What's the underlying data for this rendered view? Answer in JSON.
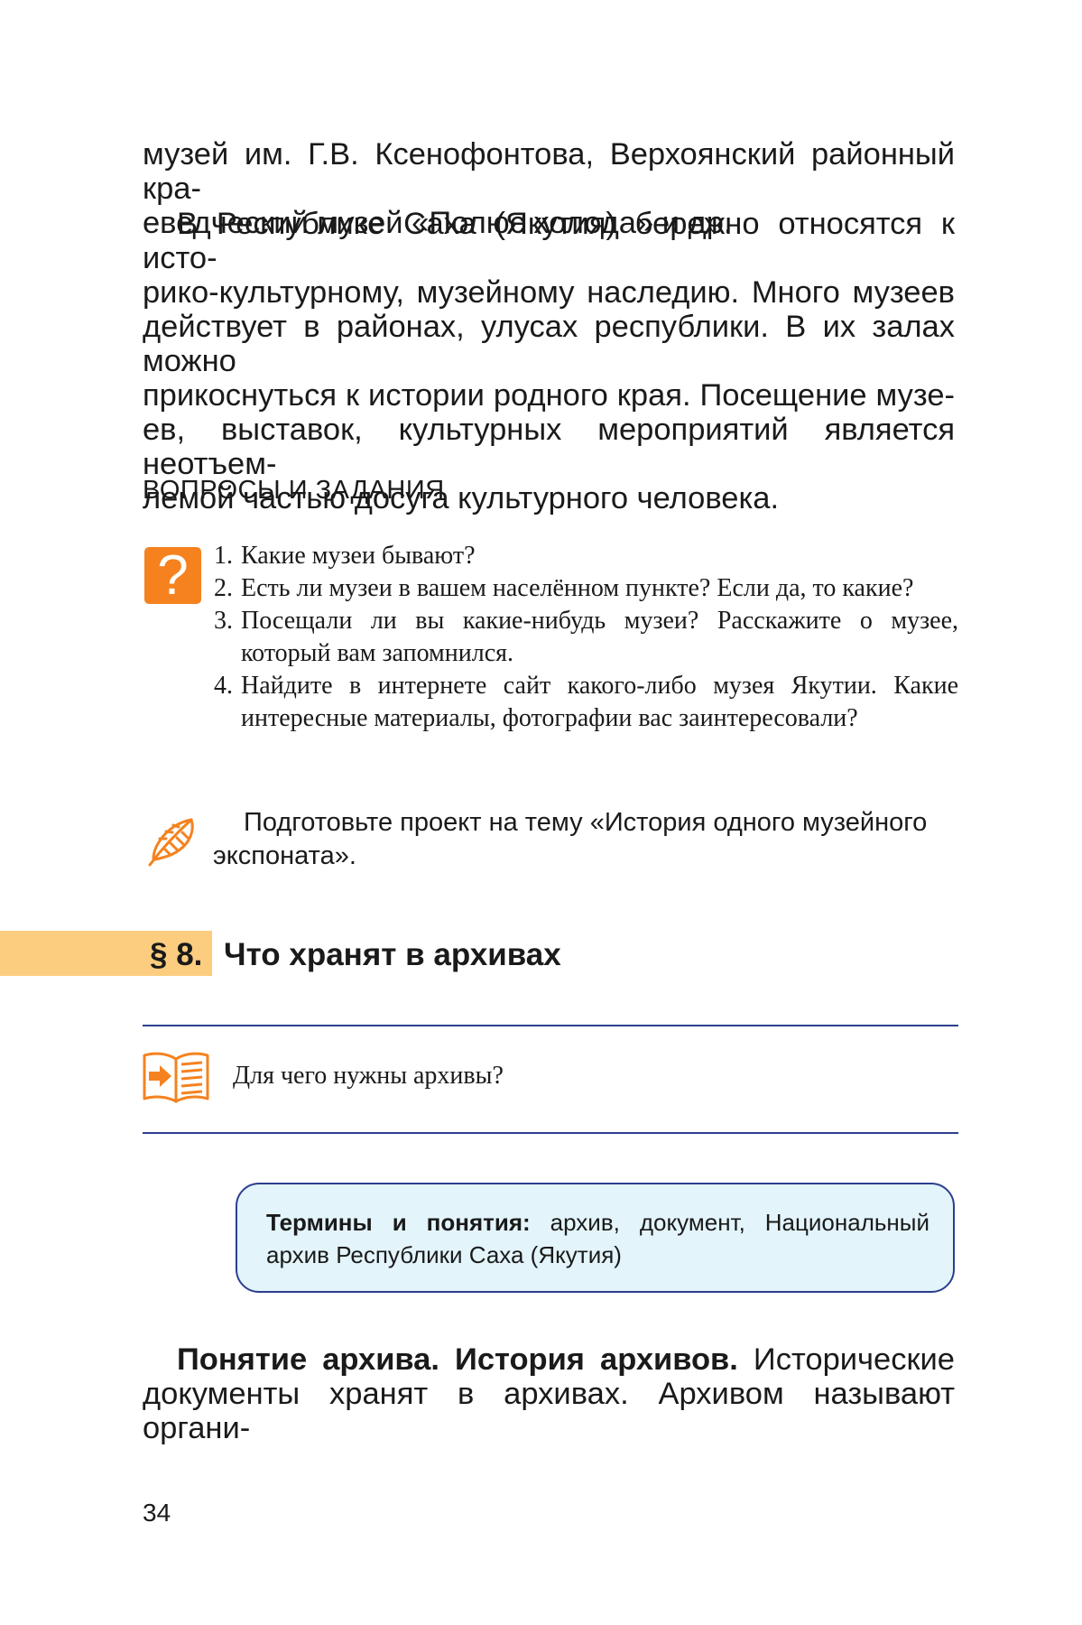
{
  "paragraph_1": {
    "lines": [
      "музей им. Г.В. Ксенофонтова, Верхоянский районный кра-",
      "еведческий музей «Полюс холода» и др."
    ]
  },
  "paragraph_2": {
    "lines": [
      "В Республике Саха (Якутия) бережно относятся к исто-",
      "рико-культурному, музейному наследию. Много музеев",
      "действует в районах, улусах республики. В их залах можно",
      "прикоснуться к истории родного края. Посещение музе-",
      "ев, выставок, культурных мероприятий является неотъем-",
      "лемой частью досуга культурного человека."
    ]
  },
  "questions": {
    "heading": "ВОПРОСЫ И ЗАДАНИЯ",
    "icon_symbol": "?",
    "items": [
      {
        "num": "1.",
        "text": "Какие музеи бывают?"
      },
      {
        "num": "2.",
        "text": "Есть ли музеи в вашем населённом пункте? Если да, то какие?"
      },
      {
        "num": "3.",
        "text": "Посещали ли вы какие-нибудь музеи? Расскажите о музее, который вам запомнился."
      },
      {
        "num": "4.",
        "text": "Найдите в интернете сайт какого-либо музея Якутии. Какие интересные материалы, фотографии вас заинтересовали?"
      }
    ]
  },
  "project": {
    "icon": "feather-icon",
    "text": "Подготовьте проект на тему «История одного музейного экспоната»."
  },
  "section": {
    "number": "§ 8.",
    "title": "Что хранят в архивах"
  },
  "key_question": {
    "icon": "open-book-icon",
    "text": "Для чего нужны архивы?"
  },
  "terms": {
    "label": "Термины и понятия:",
    "text": " архив, документ, Национальный архив Республики Саха (Якутия)"
  },
  "paragraph_3": {
    "bold_lead": "Понятие архива. История архивов.",
    "line1_rest": " Исторические",
    "line2": "документы хранят в архивах. Архивом называют органи-"
  },
  "page_number": "34",
  "colors": {
    "accent_orange": "#f5821f",
    "section_band": "#fccd7f",
    "rule_blue": "#2b3f8f",
    "terms_box_bg": "#e3f4fb"
  }
}
